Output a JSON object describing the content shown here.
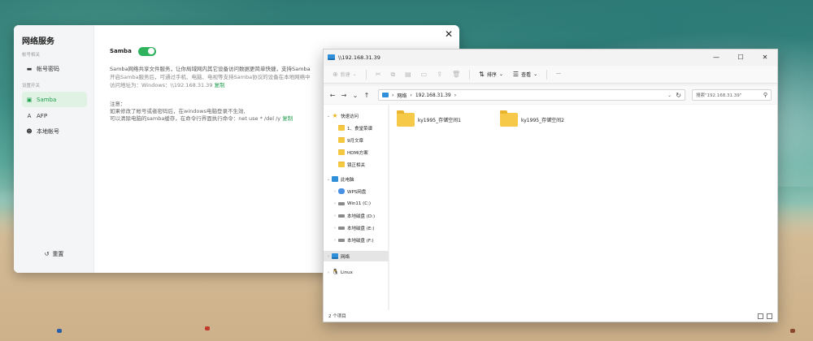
{
  "settings": {
    "title": "网络服务",
    "group_account": "帐号相关",
    "item_account": "帐号密码",
    "group_settings": "设置开关",
    "items": [
      {
        "label": "Samba",
        "active": true
      },
      {
        "label": "AFP",
        "active": false
      },
      {
        "label": "本地帐号",
        "active": false
      }
    ],
    "reset_label": "重置",
    "samba_label": "Samba",
    "samba_enabled": true,
    "desc_line1": "Samba网络共享文件服务，让你局域网内其它设备访问数据更简单快捷，支持Samba",
    "desc_line2": "开启Samba服务后，可通过手机、电脑、电视等支持Samba协议的设备在本地网络中",
    "desc_line3_prefix": "访问地址为：Windows：\\\\192.168.31.39",
    "copy_label": "复制",
    "note_title": "注意：",
    "note_line1": "如果修改了帐号或者密码后，在windows电脑登录不生效,",
    "note_line2_prefix": "可以清除电脑的samba缓存，在命令行界面执行命令：net use * /del /y",
    "copy_label2": "复制"
  },
  "explorer": {
    "title": "\\\\192.168.31.39",
    "toolbar": {
      "new_label": "新建",
      "sort_label": "排序",
      "view_label": "查看",
      "more_label": "···"
    },
    "address": {
      "root": "网络",
      "host": "192.168.31.39"
    },
    "search_placeholder": "搜索\"192.168.31.39\"",
    "tree": [
      {
        "label": "快速访问",
        "icon": "star-icon",
        "level": 0,
        "chev": "⌄"
      },
      {
        "label": "1、食堂菜谱",
        "icon": "folder-icon",
        "level": 1
      },
      {
        "label": "9月文章",
        "icon": "folder-icon",
        "level": 1
      },
      {
        "label": "HDMI方案",
        "icon": "folder-icon",
        "level": 1
      },
      {
        "label": "镜正相关",
        "icon": "folder-icon",
        "level": 1
      },
      {
        "label": "此电脑",
        "icon": "pc-icon",
        "level": 0,
        "chev": "⌄"
      },
      {
        "label": "WPS网盘",
        "icon": "cloud-icon",
        "level": 1,
        "chev": "›"
      },
      {
        "label": "Win11 (C:)",
        "icon": "drive-icon",
        "level": 1,
        "chev": "›"
      },
      {
        "label": "本地磁盘 (D:)",
        "icon": "drive-icon",
        "level": 1,
        "chev": "›"
      },
      {
        "label": "本地磁盘 (E:)",
        "icon": "drive-icon",
        "level": 1,
        "chev": "›"
      },
      {
        "label": "本地磁盘 (F:)",
        "icon": "drive-icon",
        "level": 1,
        "chev": "›"
      },
      {
        "label": "网络",
        "icon": "network-icon",
        "level": 0,
        "chev": "›",
        "selected": true
      },
      {
        "label": "Linux",
        "icon": "linux-icon",
        "level": 0,
        "chev": "›"
      }
    ],
    "shares": [
      "ky1995_存储空间1",
      "ky1995_存储空间2"
    ],
    "status": "2 个项目"
  }
}
